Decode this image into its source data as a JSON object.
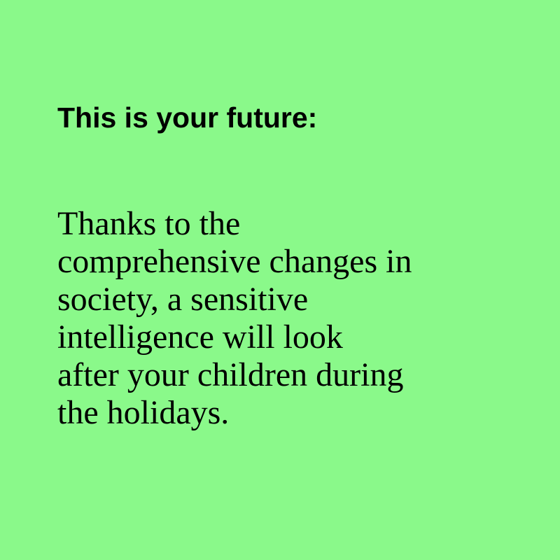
{
  "heading": "This is your future:",
  "body_lines": [
    "Thanks to the",
    "comprehensive changes in",
    "society, a sensitive",
    "intelligence will look",
    "after your children during",
    "the holidays."
  ],
  "colors": {
    "background": "#8AF98A",
    "text": "#000000"
  }
}
